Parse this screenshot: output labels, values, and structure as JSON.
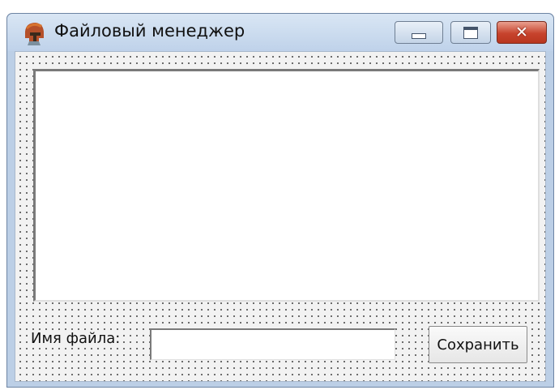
{
  "window": {
    "title": "Файловый менеджер",
    "app_icon": "spartan-helmet-icon",
    "controls": {
      "minimize": "minimize-icon",
      "maximize": "maximize-icon",
      "close": "close-icon",
      "close_glyph": "✕"
    },
    "accent": "#c7432d"
  },
  "form": {
    "file_list": {
      "items": []
    },
    "filename_label": "Имя файла:",
    "filename_value": "",
    "save_label": "Сохранить"
  }
}
